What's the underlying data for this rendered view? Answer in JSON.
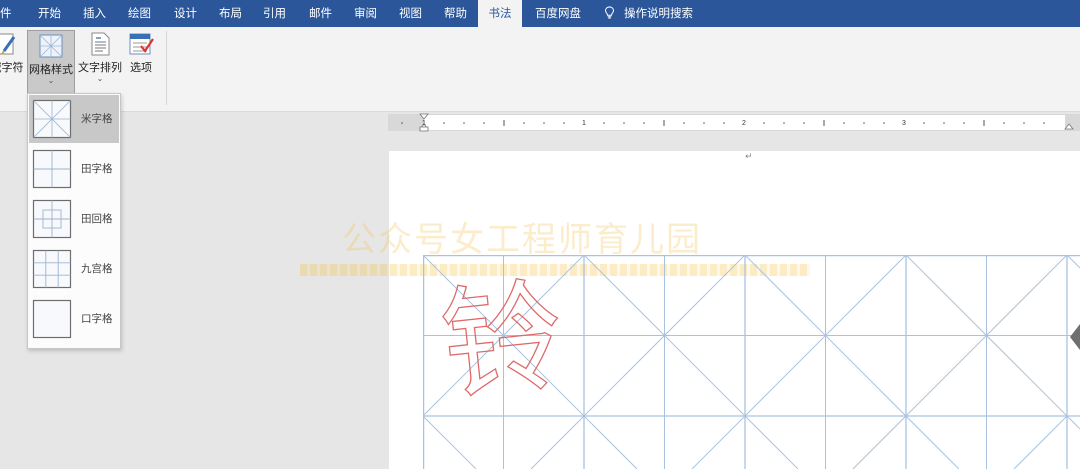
{
  "tabs": [
    {
      "label": "件"
    },
    {
      "label": "开始"
    },
    {
      "label": "插入"
    },
    {
      "label": "绘图"
    },
    {
      "label": "设计"
    },
    {
      "label": "布局"
    },
    {
      "label": "引用"
    },
    {
      "label": "邮件"
    },
    {
      "label": "审阅"
    },
    {
      "label": "视图"
    },
    {
      "label": "帮助"
    },
    {
      "label": "书法"
    },
    {
      "label": "百度网盘"
    },
    {
      "label": "操作说明搜索"
    }
  ],
  "active_tab": "书法",
  "ribbon": {
    "buttons": [
      {
        "label": "减字符"
      },
      {
        "label": "网格样式"
      },
      {
        "label": "文字排列"
      },
      {
        "label": "选项"
      }
    ]
  },
  "grid_menu": {
    "items": [
      {
        "label": "米字格",
        "selected": true
      },
      {
        "label": "田字格"
      },
      {
        "label": "田回格"
      },
      {
        "label": "九宫格"
      },
      {
        "label": "口字格"
      }
    ]
  },
  "ruler": {
    "numbers": [
      "1",
      "1",
      "2",
      "3"
    ]
  },
  "document": {
    "character": "铃",
    "grid_style": "米字格",
    "paragraph_mark": "↵",
    "watermark": "公众号女工程师育儿园"
  },
  "colors": {
    "tab_bar": "#2b579a",
    "grid_line": "#a9c3df",
    "character_outline": "#e06a6a",
    "watermark": "#f4c04a"
  }
}
